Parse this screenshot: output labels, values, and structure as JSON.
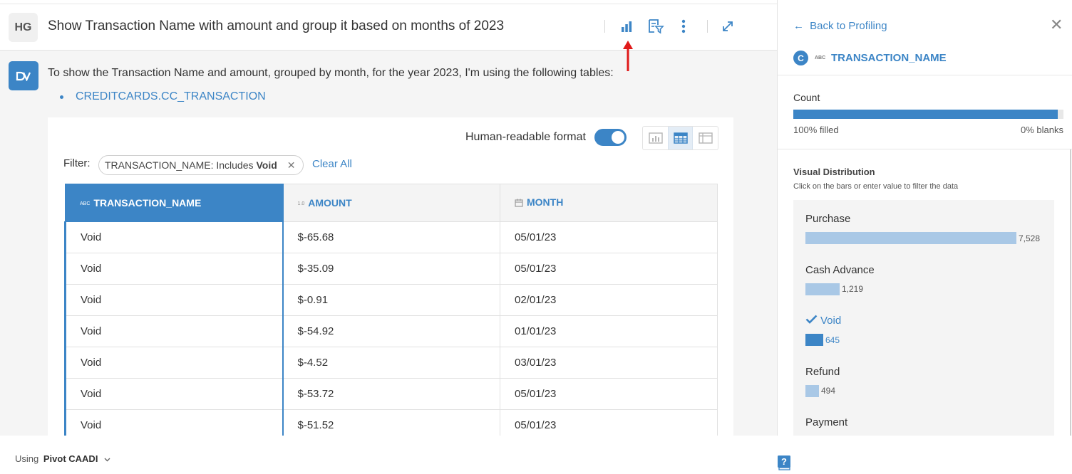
{
  "header": {
    "avatar_initials": "HG",
    "question": "Show Transaction Name with amount and group it based on months of 2023",
    "icons": [
      "bar-chart-icon",
      "filter-report-icon",
      "more-vertical-icon",
      "expand-icon"
    ]
  },
  "answer": {
    "logo_text": "DV",
    "text": "To show the Transaction Name and amount, grouped by month, for the year 2023, I'm using the following tables:",
    "tables": [
      "CREDITCARDS.CC_TRANSACTION"
    ]
  },
  "card": {
    "human_readable_label": "Human-readable format",
    "human_readable_on": true,
    "view_modes": [
      "chart",
      "table",
      "pivot"
    ],
    "active_view": "table",
    "filter_label": "Filter:",
    "filter_chip": {
      "prefix": "TRANSACTION_NAME: Includes",
      "value": "Void"
    },
    "clear_all": "Clear All"
  },
  "table": {
    "columns": [
      {
        "type_label": "ABC",
        "name": "TRANSACTION_NAME"
      },
      {
        "type_label": "1.0",
        "name": "AMOUNT"
      },
      {
        "type_label": "",
        "name": "MONTH"
      }
    ],
    "rows": [
      [
        "Void",
        "$-65.68",
        "05/01/23"
      ],
      [
        "Void",
        "$-35.09",
        "05/01/23"
      ],
      [
        "Void",
        "$-0.91",
        "02/01/23"
      ],
      [
        "Void",
        "$-54.92",
        "01/01/23"
      ],
      [
        "Void",
        "$-4.52",
        "03/01/23"
      ],
      [
        "Void",
        "$-53.72",
        "05/01/23"
      ],
      [
        "Void",
        "$-51.52",
        "05/01/23"
      ]
    ]
  },
  "footer": {
    "using_label": "Using",
    "model_name": "Pivot CAADI"
  },
  "panel": {
    "back_label": "Back to Profiling",
    "column_badge": "C",
    "column_type": "ABC",
    "column_name": "TRANSACTION_NAME",
    "count_label": "Count",
    "filled_fraction": 0.98,
    "filled_text": "100% filled",
    "blanks_text": "0% blanks",
    "dist_title": "Visual Distribution",
    "dist_subtitle": "Click on the bars or enter value to filter the data",
    "distribution": [
      {
        "label": "Purchase",
        "value": "7,528",
        "count": 7528,
        "selected": false
      },
      {
        "label": "Cash Advance",
        "value": "1,219",
        "count": 1219,
        "selected": false
      },
      {
        "label": "Void",
        "value": "645",
        "count": 645,
        "selected": true
      },
      {
        "label": "Refund",
        "value": "494",
        "count": 494,
        "selected": false
      },
      {
        "label": "Payment",
        "value": "",
        "count": 0,
        "selected": false
      }
    ]
  },
  "colors": {
    "accent": "#3c85c6",
    "bar_light": "#a9c8e6",
    "annotation_arrow": "#e01a1a"
  }
}
